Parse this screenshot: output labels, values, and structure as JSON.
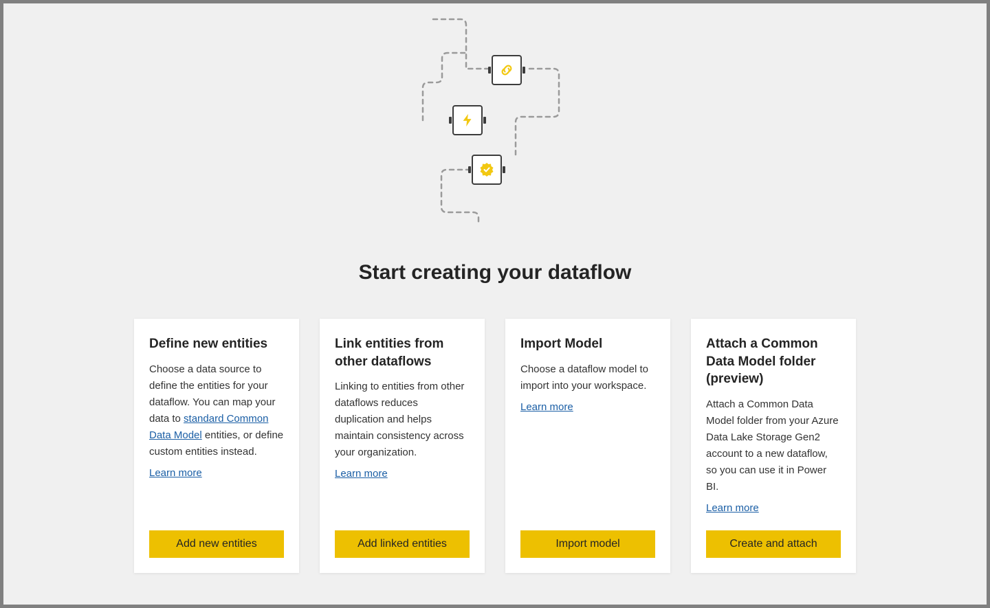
{
  "header": {
    "title": "Start creating your dataflow"
  },
  "cards": [
    {
      "title": "Define new entities",
      "desc_before": "Choose a data source to define the entities for your dataflow. You can map your data to ",
      "link_text": "standard Common Data Model",
      "desc_after": " entities, or define custom entities instead.",
      "learn_more": "Learn more",
      "button": "Add new entities"
    },
    {
      "title": "Link entities from other dataflows",
      "desc": "Linking to entities from other dataflows reduces duplication and helps maintain consistency across your organization.",
      "learn_more": "Learn more",
      "button": "Add linked entities"
    },
    {
      "title": "Import Model",
      "desc": "Choose a dataflow model to import into your workspace.",
      "learn_more": "Learn more",
      "button": "Import model"
    },
    {
      "title": "Attach a Common Data Model folder (preview)",
      "desc": "Attach a Common Data Model folder from your Azure Data Lake Storage Gen2 account to a new dataflow, so you can use it in Power BI.",
      "learn_more": "Learn more",
      "button": "Create and attach"
    }
  ]
}
